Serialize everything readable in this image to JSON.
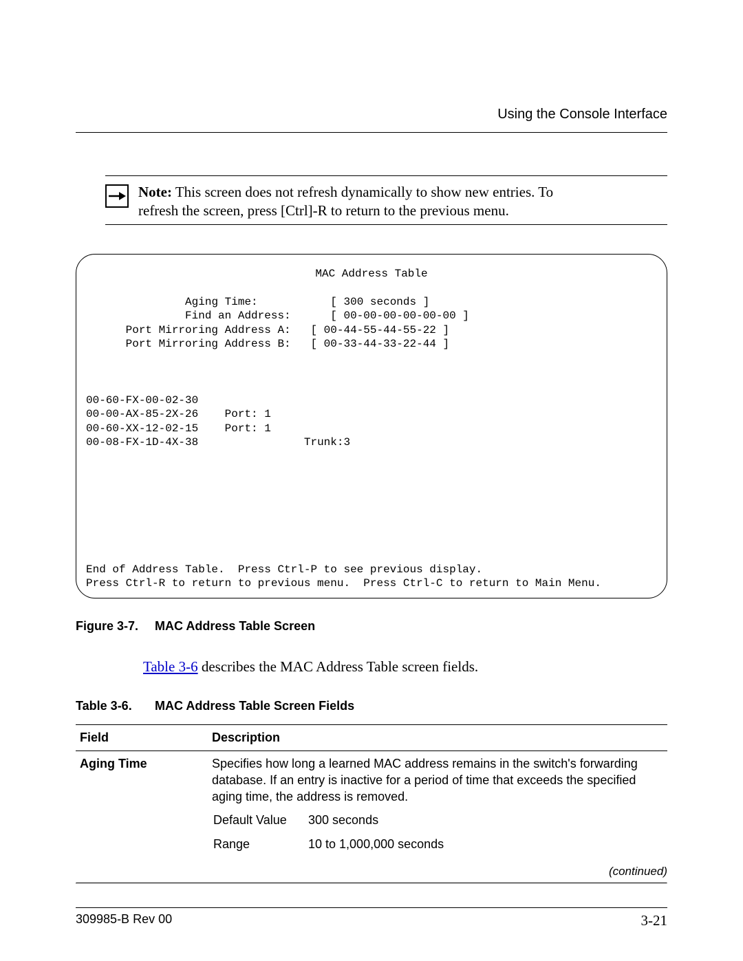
{
  "header": {
    "section_title": "Using the Console Interface"
  },
  "note": {
    "label": "Note:",
    "body_line1": " This screen does not refresh dynamically to show new entries. To",
    "body_line2": "refresh the screen, press [Ctrl]-R to return to the previous menu."
  },
  "screen": {
    "title": "MAC Address Table",
    "fields": {
      "aging_label": "Aging Time:",
      "aging_value": "[ 300 seconds ]",
      "find_label": "Find an Address:",
      "find_value": "[ 00-00-00-00-00-00 ]",
      "pma_label": "Port Mirroring Address A:",
      "pma_value": "[ 00-44-55-44-55-22 ]",
      "pmb_label": "Port Mirroring Address B:",
      "pmb_value": "[ 00-33-44-33-22-44 ]"
    },
    "list": [
      {
        "mac": "00-60-FX-00-02-30",
        "port": ""
      },
      {
        "mac": "00-00-AX-85-2X-26",
        "port": "Port: 1"
      },
      {
        "mac": "00-60-XX-12-02-15",
        "port": "Port: 1"
      },
      {
        "mac": "00-08-FX-1D-4X-38",
        "port": "            Trunk:3"
      }
    ],
    "footer1": "End of Address Table.  Press Ctrl-P to see previous display.",
    "footer2": "Press Ctrl-R to return to previous menu.  Press Ctrl-C to return to Main Menu."
  },
  "figure_caption": {
    "number": "Figure 3-7.",
    "title": "MAC Address Table Screen"
  },
  "body": {
    "tableref_link": "Table 3-6",
    "tableref_tail": " describes the MAC Address Table screen fields."
  },
  "table_caption": {
    "number": "Table 3-6.",
    "title": "MAC Address Table Screen Fields"
  },
  "table": {
    "head_field": "Field",
    "head_desc": "Description",
    "row1_field": "Aging Time",
    "row1_desc": "Specifies how long a learned MAC address remains in the switch's forwarding database. If an entry is inactive for a period of time that exceeds the specified aging time, the address is removed.",
    "row1_default_label": "Default Value",
    "row1_default_value": "300 seconds",
    "row1_range_label": "Range",
    "row1_range_value": "10 to 1,000,000 seconds"
  },
  "continued": "(continued)",
  "footer": {
    "doc": "309985-B Rev 00",
    "page": "3-21"
  }
}
